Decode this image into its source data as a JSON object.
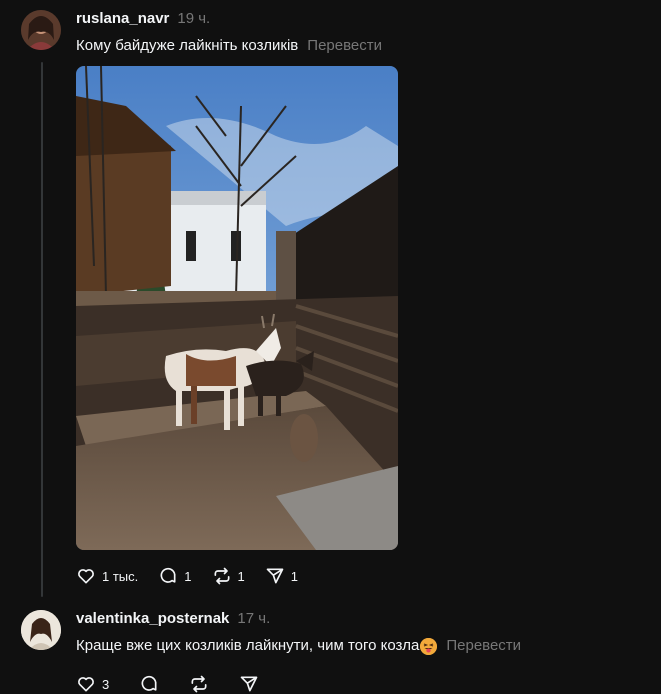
{
  "post1": {
    "username": "ruslana_navr",
    "time": "19 ч.",
    "text": "Кому байдуже лайкніть козликів",
    "translate": "Перевести",
    "likes": "1 тыс.",
    "replies": "1",
    "reposts": "1",
    "shares": "1"
  },
  "post2": {
    "username": "valentinka_posternak",
    "time": "17 ч.",
    "text": "Краще вже цих козликів лайкнути, чим того козла",
    "emoji": "squinting-tongue-emoji",
    "translate": "Перевести",
    "likes": "3"
  },
  "icons": {
    "like": "heart-icon",
    "reply": "comment-icon",
    "repost": "repost-icon",
    "share": "send-icon"
  },
  "colors": {
    "background": "#101010",
    "text": "#f3f5f7",
    "muted": "#777777"
  }
}
